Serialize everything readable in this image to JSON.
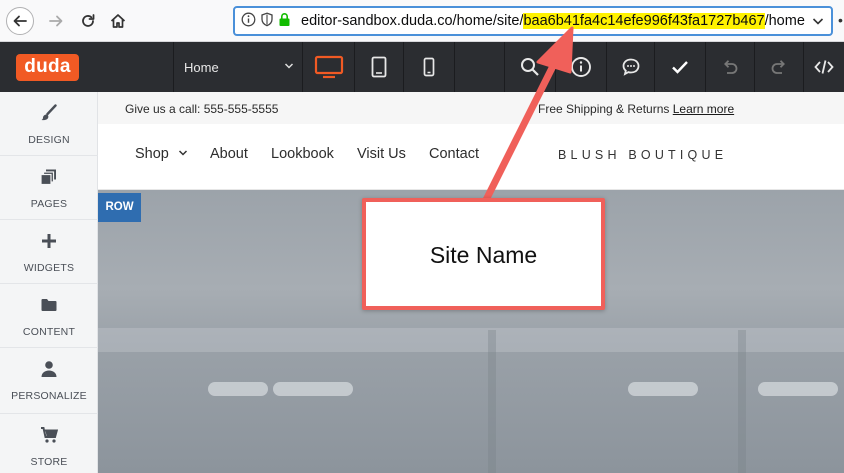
{
  "browser": {
    "url_prefix": "editor-sandbox.duda.co/home/site/",
    "url_site_id": "baa6b41fa4c14efe996f43fa1727b467",
    "url_suffix": "/home",
    "more": "•"
  },
  "toolbar": {
    "logo": "duda",
    "page_select": "Home"
  },
  "sidebar": {
    "items": [
      {
        "label": "DESIGN",
        "icon": "brush-icon"
      },
      {
        "label": "PAGES",
        "icon": "pages-icon"
      },
      {
        "label": "WIDGETS",
        "icon": "plus-icon"
      },
      {
        "label": "CONTENT",
        "icon": "folder-icon"
      },
      {
        "label": "PERSONALIZE",
        "icon": "person-icon"
      },
      {
        "label": "STORE",
        "icon": "cart-icon"
      }
    ]
  },
  "site": {
    "call_text": "Give us a call: 555-555-5555",
    "shipping_text": "Free Shipping & Returns ",
    "learn_more": "Learn more",
    "nav": [
      "Shop",
      "About",
      "Lookbook",
      "Visit Us",
      "Contact"
    ],
    "brand": "BLUSH BOUTIQUE",
    "row_badge": "ROW"
  },
  "annotation": {
    "label": "Site Name"
  },
  "colors": {
    "accent": "#f15a24",
    "toolbar": "#2b2d31",
    "highlight": "#fff200",
    "callout_border": "#f0605a",
    "row_badge": "#2f6db0"
  }
}
